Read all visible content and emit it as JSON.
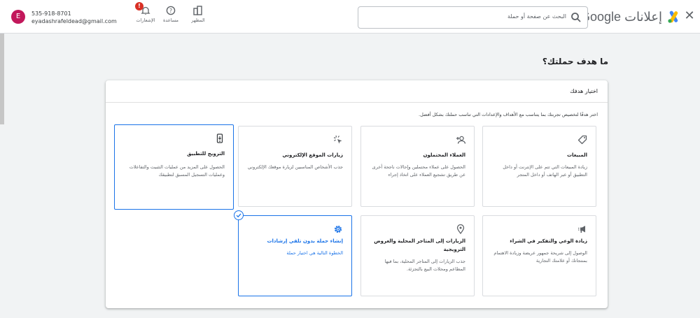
{
  "header": {
    "brand_google": "Google",
    "brand_ads": "إعلانات",
    "search_placeholder": "البحث عن صفحة أو حملة",
    "tools": [
      {
        "label": "المظهر"
      },
      {
        "label": "مساعدة"
      },
      {
        "label": "الإشعارات",
        "badge": "!"
      }
    ],
    "account": {
      "initial": "E",
      "phone": "535-918-8701",
      "email": "eyadashrafeldead@gmail.com"
    }
  },
  "page_heading": "ما هدف حملتك؟",
  "card": {
    "title": "اختيار هدفك",
    "instruction": "اختر هدفًا لتخصيص تجربتك بما يتناسب مع الأهداف والإعدادات التي تناسب حملتك بشكل أفضل."
  },
  "goals": [
    {
      "title": "المبيعات",
      "description": "زيادة المبيعات التي تتم على الإنترنت أو داخل التطبيق أو عبر الهاتف أو داخل المتجر",
      "icon": "tag-icon"
    },
    {
      "title": "العملاء المحتملون",
      "description": "الحصول على عملاء محتملين وإحالات ناجحة أخرى عن طريق تشجيع العملاء على اتخاذ إجراء",
      "icon": "person-add-icon"
    },
    {
      "title": "زيارات الموقع الإلكتروني",
      "description": "جذب الأشخاص المناسبين لزيارة موقعك الإلكتروني",
      "icon": "cursor-click-icon"
    },
    {
      "title": "الترويج للتطبيق",
      "description": "الحصول على المزيد من عمليات التثبيت والتفاعلات وعمليات التسجيل المسبق لتطبيقك",
      "icon": "phone-app-icon"
    },
    {
      "title": "زيادة الوعي والتفكير في الشراء",
      "description": "الوصول إلى شريحة جمهور عريضة وزيادة الاهتمام بمنتجاتك أو علامتك التجارية",
      "icon": "megaphone-icon"
    },
    {
      "title": "الزيارات إلى المتاجر المحلية والعروض الترويجية",
      "description": "جذب الزيارات إلى المتاجر المحلية، بما فيها المطاعم ومحلات البيع بالتجزئة.",
      "icon": "location-pin-icon"
    },
    {
      "title": "إنشاء حملة بدون تلقي إرشادات",
      "description": "الخطوة التالية هي اختيار حملة",
      "icon": "gear-icon",
      "selected": true
    }
  ],
  "colors": {
    "accent": "#1a73e8",
    "avatar": "#c2185b",
    "badge": "#d93025"
  }
}
